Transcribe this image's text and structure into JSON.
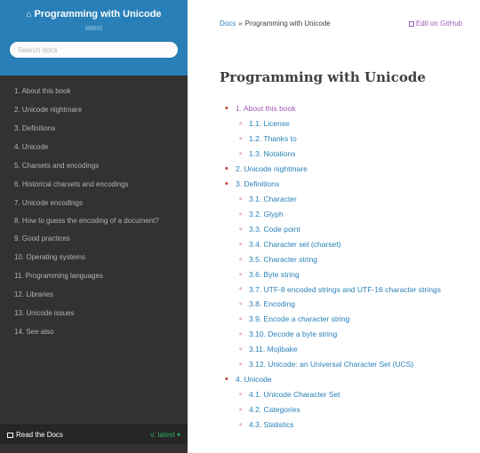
{
  "sidebar": {
    "project_title": "Programming with Unicode",
    "version": "latest",
    "search_placeholder": "Search docs",
    "items": [
      "1. About this book",
      "2. Unicode nightmare",
      "3. Definitions",
      "4. Unicode",
      "5. Charsets and encodings",
      "6. Historical charsets and encodings",
      "7. Unicode encodings",
      "8. How to guess the encoding of a document?",
      "9. Good practices",
      "10. Operating systems",
      "11. Programming languages",
      "12. Libraries",
      "13. Unicode issues",
      "14. See also"
    ],
    "rtd_label": "Read the Docs",
    "rtd_version": "v: latest"
  },
  "breadcrumb": {
    "docs": "Docs",
    "separator": "»",
    "current": "Programming with Unicode"
  },
  "edit_label": "Edit on GitHub",
  "page_title": "Programming with Unicode",
  "toc": {
    "about": {
      "label": "1. About this book",
      "children": [
        "1.1. License",
        "1.2. Thanks to",
        "1.3. Notations"
      ]
    },
    "nightmare": {
      "label": "2. Unicode nightmare"
    },
    "definitions": {
      "label": "3. Definitions",
      "children": [
        "3.1. Character",
        "3.2. Glyph",
        "3.3. Code point",
        "3.4. Character set (charset)",
        "3.5. Character string",
        "3.6. Byte string",
        "3.7. UTF-8 encoded strings and UTF-16 character strings",
        "3.8. Encoding",
        "3.9. Encode a character string",
        "3.10. Decode a byte string",
        "3.11. Mojibake",
        "3.12. Unicode: an Universal Character Set (UCS)"
      ]
    },
    "unicode": {
      "label": "4. Unicode",
      "children": [
        "4.1. Unicode Character Set",
        "4.2. Categories",
        "4.3. Statistics"
      ]
    }
  },
  "colors": {
    "sidebar_bg": "#343131",
    "header_bg": "#2980b9",
    "link": "#2980b9",
    "visited": "#9b59b6",
    "bullet": "#c0392b"
  }
}
